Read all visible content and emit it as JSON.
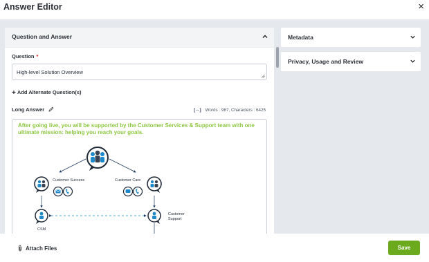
{
  "dialog": {
    "title": "Answer Editor",
    "close_symbol": "×"
  },
  "question_answer": {
    "section_title": "Question and Answer",
    "question_label": "Question",
    "required_mark": "*",
    "question_value": "High-level Solution Overview",
    "add_alternate_label": "Add Alternate Question(s)",
    "long_answer_label": "Long Answer",
    "expand_symbol": "[↔]",
    "stats": "Words : 967, Characters : 6425",
    "intro_text": "After going live, you will be supported by the Customer Services & Support team with one ultimate mission: helping you reach your goals.",
    "diagram": {
      "customer_success": "Customer Success",
      "customer_care": "Customer Care",
      "csm": "CSM",
      "customer_support_line1": "Customer",
      "customer_support_line2": "Support"
    }
  },
  "right_sections": [
    {
      "label": "Metadata"
    },
    {
      "label": "Privacy, Usage and Review"
    }
  ],
  "footer": {
    "attach_label": "Attach Files",
    "save_label": "Save"
  },
  "colors": {
    "accent_green": "#8cc63f",
    "save_green": "#6aaa1c",
    "icon_blue": "#1e88c8"
  }
}
